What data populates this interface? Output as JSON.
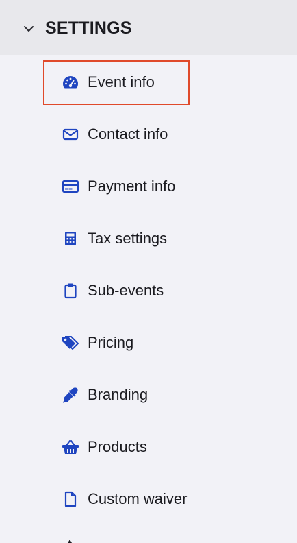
{
  "header": {
    "title": "SETTINGS",
    "toggle_icon": "chevron-down-icon"
  },
  "items": [
    {
      "label": "Event info",
      "icon": "dashboard-gauge-icon",
      "selected": true
    },
    {
      "label": "Contact info",
      "icon": "envelope-icon",
      "selected": false
    },
    {
      "label": "Payment info",
      "icon": "credit-card-icon",
      "selected": false
    },
    {
      "label": "Tax settings",
      "icon": "calculator-icon",
      "selected": false
    },
    {
      "label": "Sub-events",
      "icon": "clipboard-icon",
      "selected": false
    },
    {
      "label": "Pricing",
      "icon": "tags-icon",
      "selected": false
    },
    {
      "label": "Branding",
      "icon": "eyedropper-icon",
      "selected": false
    },
    {
      "label": "Products",
      "icon": "basket-icon",
      "selected": false
    },
    {
      "label": "Custom waiver",
      "icon": "document-icon",
      "selected": false
    }
  ],
  "colors": {
    "accent": "#1f45c0",
    "text": "#1b1b20",
    "background": "#f2f2f7",
    "header_background": "#e8e8ec",
    "highlight_border": "#e04a2b"
  }
}
